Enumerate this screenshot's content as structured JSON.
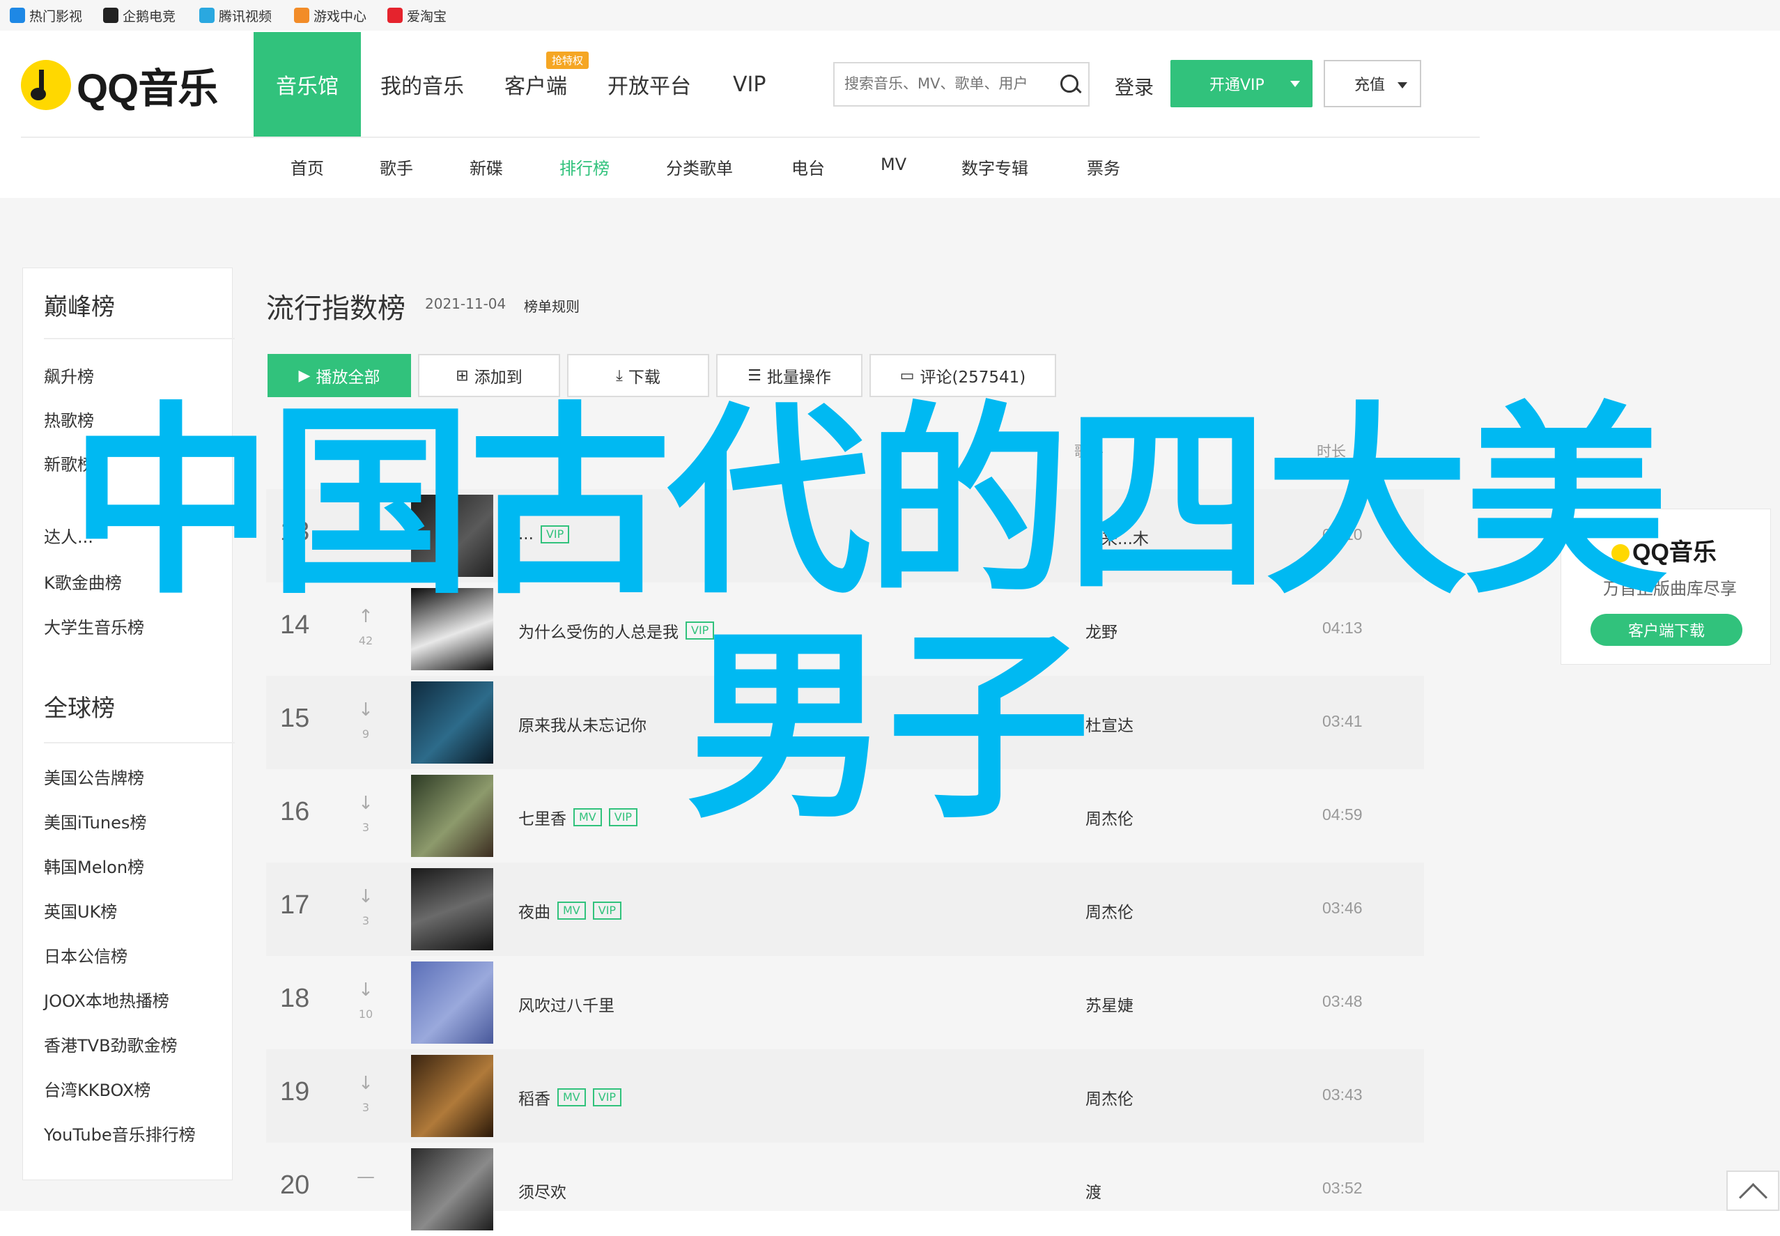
{
  "bookmarks": [
    {
      "label": "热门影视",
      "color": "#1e88e5"
    },
    {
      "label": "企鹅电竞",
      "color": "#222222"
    },
    {
      "label": "腾讯视频",
      "color": "#2aa8e0"
    },
    {
      "label": "游戏中心",
      "color": "#f28c28"
    },
    {
      "label": "爱淘宝",
      "color": "#e5232d"
    }
  ],
  "header": {
    "logo_text": "QQ音乐",
    "nav": [
      "音乐馆",
      "我的音乐",
      "客户端",
      "开放平台",
      "VIP"
    ],
    "client_badge": "抢特权",
    "search_placeholder": "搜索音乐、MV、歌单、用户",
    "login": "登录",
    "vip_button": "开通VIP",
    "charge_button": "充值",
    "subnav": [
      "首页",
      "歌手",
      "新碟",
      "排行榜",
      "分类歌单",
      "电台",
      "MV",
      "数字专辑",
      "票务"
    ]
  },
  "sidebar": {
    "peak_title": "巅峰榜",
    "peak_items": [
      "飙升榜",
      "热歌榜",
      "新歌榜",
      "达人...",
      "K歌金曲榜",
      "大学生音乐榜"
    ],
    "global_title": "全球榜",
    "global_items": [
      "美国公告牌榜",
      "美国iTunes榜",
      "韩国Melon榜",
      "英国UK榜",
      "日本公信榜",
      "JOOX本地热播榜",
      "香港TVB劲歌金榜",
      "台湾KKBOX榜",
      "YouTube音乐排行榜"
    ]
  },
  "main": {
    "title": "流行指数榜",
    "date": "2021-11-04",
    "rules": "榜单规则",
    "buttons": [
      "播放全部",
      "添加到",
      "下载",
      "批量操作",
      "评论(257541)"
    ],
    "columns": {
      "singer": "歌手",
      "duration": "时长"
    },
    "rows": [
      {
        "rank": "13",
        "trend": "",
        "trend_num": "",
        "song": "...",
        "tags": [
          "VIP"
        ],
        "singer": "海来...木",
        "duration": "05:10"
      },
      {
        "rank": "14",
        "trend": "↑",
        "trend_num": "42",
        "song": "为什么受伤的人总是我",
        "tags": [
          "VIP"
        ],
        "singer": "龙野",
        "duration": "04:13"
      },
      {
        "rank": "15",
        "trend": "↓",
        "trend_num": "9",
        "song": "原来我从未忘记你",
        "tags": [],
        "singer": "杜宣达",
        "duration": "03:41"
      },
      {
        "rank": "16",
        "trend": "↓",
        "trend_num": "3",
        "song": "七里香",
        "tags": [
          "MV",
          "VIP"
        ],
        "singer": "周杰伦",
        "duration": "04:59"
      },
      {
        "rank": "17",
        "trend": "↓",
        "trend_num": "3",
        "song": "夜曲",
        "tags": [
          "MV",
          "VIP"
        ],
        "singer": "周杰伦",
        "duration": "03:46"
      },
      {
        "rank": "18",
        "trend": "↓",
        "trend_num": "10",
        "song": "风吹过八千里",
        "tags": [],
        "singer": "苏星婕",
        "duration": "03:48"
      },
      {
        "rank": "19",
        "trend": "↓",
        "trend_num": "3",
        "song": "稻香",
        "tags": [
          "MV",
          "VIP"
        ],
        "singer": "周杰伦",
        "duration": "03:43"
      },
      {
        "rank": "20",
        "trend": "—",
        "trend_num": "",
        "song": "须尽欢",
        "tags": [],
        "singer": "渡",
        "duration": "03:52"
      }
    ]
  },
  "right_card": {
    "logo": "QQ音乐",
    "desc": "万首正版曲库尽享",
    "download": "客户端下载"
  },
  "overlay": {
    "line1": "中国古代的四大美",
    "line2": "男子"
  },
  "colors": {
    "brand_green": "#31c27c",
    "overlay_blue": "#00b9f2"
  }
}
